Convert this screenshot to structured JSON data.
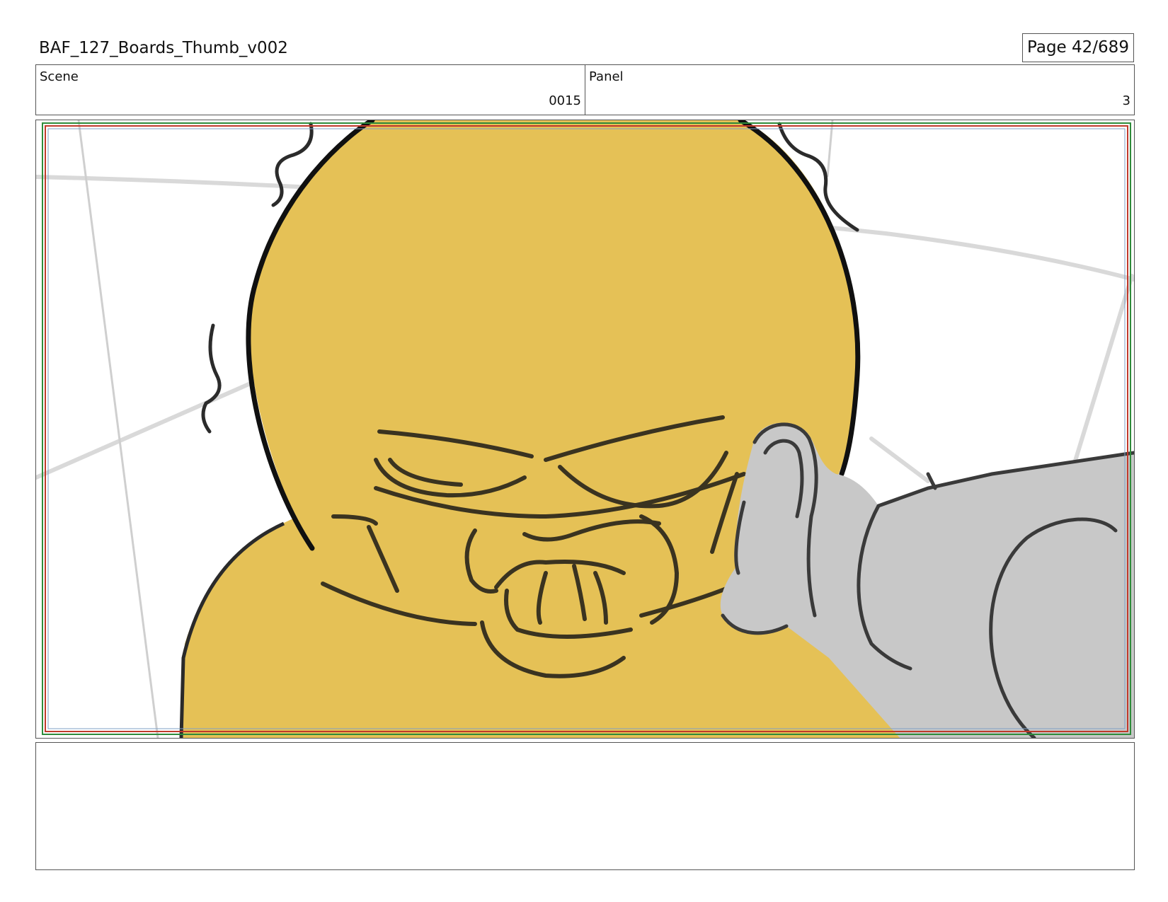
{
  "header": {
    "title": "BAF_127_Boards_Thumb_v002",
    "page_label": "Page",
    "page_value": "42/689"
  },
  "info": {
    "scene_label": "Scene",
    "scene_value": "0015",
    "panel_label": "Panel",
    "panel_value": "3"
  },
  "notes": {
    "text": ""
  },
  "colors": {
    "character_yellow": "#e5c156",
    "arm_gray": "#c8c8c8",
    "safe_red": "#c0392b",
    "safe_green": "#2e8b3a"
  }
}
